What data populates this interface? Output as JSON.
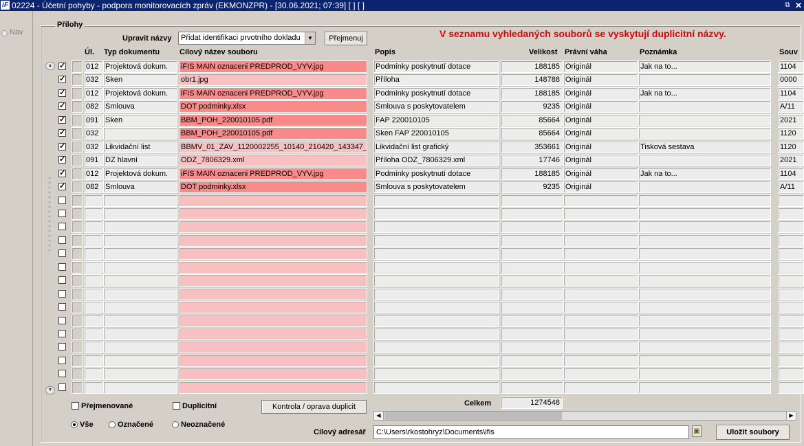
{
  "window": {
    "logo": "iF",
    "title": "02224 - Účetní pohyby - podpora monitorovacích zpráv (EKMONZPR) - [30.06.2021; 07:39]  [ ] [ ]",
    "restore_glyph": "⧉",
    "close_glyph": "✕"
  },
  "nav": {
    "label": "Nav"
  },
  "section": {
    "title": "Přílohy"
  },
  "rename": {
    "label": "Upravit názvy",
    "selected": "Přidat identifikaci prvotního dokladu",
    "button": "Přejmenuj"
  },
  "warning": "V seznamu vyhledaných souborů se vyskytují duplicitní názvy.",
  "columns": {
    "ul": "Úl.",
    "typ": "Typ dokumentu",
    "cil": "Cílový název souboru",
    "popis": "Popis",
    "velikost": "Velikost",
    "pravni": "Právní váha",
    "poznamka": "Poznámka",
    "souv": "Souv"
  },
  "rows": [
    {
      "checked": true,
      "ul": "012",
      "typ": "Projektová dokum.",
      "cil": "iFIS MAIN oznaceni PREDPROD_VYV.jpg",
      "dup": true,
      "popis": "Podmínky poskytnutí dotace",
      "velikost": "188185",
      "pravni": "Originál",
      "poznamka": "Jak na to...",
      "souv": "1104"
    },
    {
      "checked": true,
      "ul": "032",
      "typ": "Sken",
      "cil": "obr1.jpg",
      "dup": false,
      "popis": "Příloha",
      "velikost": "148788",
      "pravni": "Originál",
      "poznamka": "",
      "souv": "0000"
    },
    {
      "checked": true,
      "ul": "012",
      "typ": "Projektová dokum.",
      "cil": "iFIS MAIN oznaceni PREDPROD_VYV.jpg",
      "dup": true,
      "popis": "Podmínky poskytnutí dotace",
      "velikost": "188185",
      "pravni": "Originál",
      "poznamka": "Jak na to...",
      "souv": "1104"
    },
    {
      "checked": true,
      "ul": "082",
      "typ": "Smlouva",
      "cil": "DOT podminky.xlsx",
      "dup": true,
      "popis": "Smlouva s poskytovatelem",
      "velikost": "9235",
      "pravni": "Originál",
      "poznamka": "",
      "souv": "A/11"
    },
    {
      "checked": true,
      "ul": "091",
      "typ": "Sken",
      "cil": "BBM_POH_220010105.pdf",
      "dup": true,
      "popis": "FAP 220010105",
      "velikost": "85664",
      "pravni": "Originál",
      "poznamka": "",
      "souv": "2021"
    },
    {
      "checked": true,
      "ul": "032",
      "typ": "",
      "cil": "BBM_POH_220010105.pdf",
      "dup": true,
      "popis": "Sken FAP 220010105",
      "velikost": "85664",
      "pravni": "Originál",
      "poznamka": "",
      "souv": "1120"
    },
    {
      "checked": true,
      "ul": "032",
      "typ": "Likvidační list",
      "cil": "BBMV_01_ZAV_1120002255_10140_210420_143347_",
      "dup": false,
      "popis": "Likvidační list grafický",
      "velikost": "353661",
      "pravni": "Originál",
      "poznamka": "Tisková sestava",
      "souv": "1120"
    },
    {
      "checked": true,
      "ul": "091",
      "typ": "DZ hlavní",
      "cil": "ODZ_7806329.xml",
      "dup": false,
      "popis": "Příloha ODZ_7806329.xml",
      "velikost": "17746",
      "pravni": "Originál",
      "poznamka": "",
      "souv": "2021"
    },
    {
      "checked": true,
      "ul": "012",
      "typ": "Projektová dokum.",
      "cil": "iFIS MAIN oznaceni PREDPROD_VYV.jpg",
      "dup": true,
      "popis": "Podmínky poskytnutí dotace",
      "velikost": "188185",
      "pravni": "Originál",
      "poznamka": "Jak na to...",
      "souv": "1104"
    },
    {
      "checked": true,
      "ul": "082",
      "typ": "Smlouva",
      "cil": "DOT podminky.xlsx",
      "dup": true,
      "popis": "Smlouva s poskytovatelem",
      "velikost": "9235",
      "pravni": "Originál",
      "poznamka": "",
      "souv": "A/11"
    },
    {
      "checked": false,
      "ul": "",
      "typ": "",
      "cil": "",
      "dup": false,
      "popis": "",
      "velikost": "",
      "pravni": "",
      "poznamka": "",
      "souv": ""
    },
    {
      "checked": false,
      "ul": "",
      "typ": "",
      "cil": "",
      "dup": false,
      "popis": "",
      "velikost": "",
      "pravni": "",
      "poznamka": "",
      "souv": ""
    },
    {
      "checked": false,
      "ul": "",
      "typ": "",
      "cil": "",
      "dup": false,
      "popis": "",
      "velikost": "",
      "pravni": "",
      "poznamka": "",
      "souv": ""
    },
    {
      "checked": false,
      "ul": "",
      "typ": "",
      "cil": "",
      "dup": false,
      "popis": "",
      "velikost": "",
      "pravni": "",
      "poznamka": "",
      "souv": ""
    },
    {
      "checked": false,
      "ul": "",
      "typ": "",
      "cil": "",
      "dup": false,
      "popis": "",
      "velikost": "",
      "pravni": "",
      "poznamka": "",
      "souv": ""
    },
    {
      "checked": false,
      "ul": "",
      "typ": "",
      "cil": "",
      "dup": false,
      "popis": "",
      "velikost": "",
      "pravni": "",
      "poznamka": "",
      "souv": ""
    },
    {
      "checked": false,
      "ul": "",
      "typ": "",
      "cil": "",
      "dup": false,
      "popis": "",
      "velikost": "",
      "pravni": "",
      "poznamka": "",
      "souv": ""
    },
    {
      "checked": false,
      "ul": "",
      "typ": "",
      "cil": "",
      "dup": false,
      "popis": "",
      "velikost": "",
      "pravni": "",
      "poznamka": "",
      "souv": ""
    },
    {
      "checked": false,
      "ul": "",
      "typ": "",
      "cil": "",
      "dup": false,
      "popis": "",
      "velikost": "",
      "pravni": "",
      "poznamka": "",
      "souv": ""
    },
    {
      "checked": false,
      "ul": "",
      "typ": "",
      "cil": "",
      "dup": false,
      "popis": "",
      "velikost": "",
      "pravni": "",
      "poznamka": "",
      "souv": ""
    },
    {
      "checked": false,
      "ul": "",
      "typ": "",
      "cil": "",
      "dup": false,
      "popis": "",
      "velikost": "",
      "pravni": "",
      "poznamka": "",
      "souv": ""
    },
    {
      "checked": false,
      "ul": "",
      "typ": "",
      "cil": "",
      "dup": false,
      "popis": "",
      "velikost": "",
      "pravni": "",
      "poznamka": "",
      "souv": ""
    },
    {
      "checked": false,
      "ul": "",
      "typ": "",
      "cil": "",
      "dup": false,
      "popis": "",
      "velikost": "",
      "pravni": "",
      "poznamka": "",
      "souv": ""
    },
    {
      "checked": false,
      "ul": "",
      "typ": "",
      "cil": "",
      "dup": false,
      "popis": "",
      "velikost": "",
      "pravni": "",
      "poznamka": "",
      "souv": ""
    },
    {
      "checked": false,
      "ul": "",
      "typ": "",
      "cil": "",
      "dup": false,
      "popis": "",
      "velikost": "",
      "pravni": "",
      "poznamka": "",
      "souv": ""
    }
  ],
  "filters": {
    "prejmenovane": "Přejmenované",
    "duplicitni": "Duplicitní",
    "kontrola_button": "Kontrola / oprava duplicit",
    "vse": "Vše",
    "oznacene": "Označené",
    "neoznacene": "Neoznačené"
  },
  "total": {
    "label": "Celkem",
    "value": "1274548"
  },
  "target": {
    "label": "Cílový adresář",
    "path": "C:\\Users\\rkostohryz\\Documents\\ifis",
    "save_button": "Uložit soubory"
  },
  "colors": {
    "duplicate": "#f88a8a",
    "target_name": "#f8c0c0",
    "warning": "#e00000"
  }
}
